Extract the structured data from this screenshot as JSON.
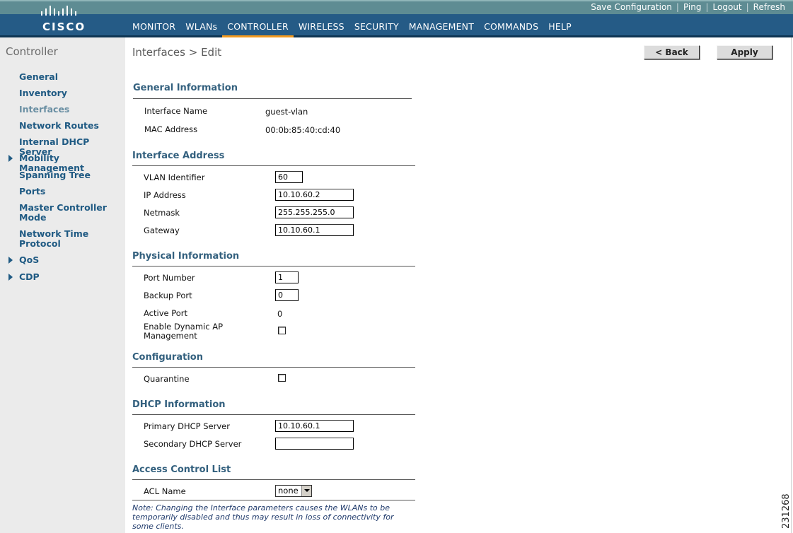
{
  "brand": {
    "logo_text": "CISCO"
  },
  "top_links": [
    "Save Configuration",
    "Ping",
    "Logout",
    "Refresh"
  ],
  "nav": {
    "items": [
      "MONITOR",
      "WLANs",
      "CONTROLLER",
      "WIRELESS",
      "SECURITY",
      "MANAGEMENT",
      "COMMANDS",
      "HELP"
    ],
    "active": "CONTROLLER",
    "active_color": "#f39a1f"
  },
  "sidebar": {
    "title": "Controller",
    "items": [
      {
        "label": "General",
        "expandable": false
      },
      {
        "label": "Inventory",
        "expandable": false
      },
      {
        "label": "Interfaces",
        "expandable": false,
        "active": true
      },
      {
        "label": "Network Routes",
        "expandable": false
      },
      {
        "label": "Internal DHCP Server",
        "expandable": false
      },
      {
        "label": "Mobility Management",
        "expandable": true
      },
      {
        "label": "Spanning Tree",
        "expandable": false
      },
      {
        "label": "Ports",
        "expandable": false
      },
      {
        "label": "Master Controller Mode",
        "expandable": false
      },
      {
        "label": "Network Time Protocol",
        "expandable": false
      },
      {
        "label": "QoS",
        "expandable": true
      },
      {
        "label": "CDP",
        "expandable": true
      }
    ]
  },
  "page": {
    "title": "Interfaces > Edit",
    "back_label": "< Back",
    "apply_label": "Apply"
  },
  "general": {
    "title": "General Information",
    "interface_name_label": "Interface Name",
    "interface_name": "guest-vlan",
    "mac_label": "MAC Address",
    "mac": "00:0b:85:40:cd:40"
  },
  "address": {
    "title": "Interface Address",
    "vlan_label": "VLAN Identifier",
    "vlan": "60",
    "ip_label": "IP Address",
    "ip": "10.10.60.2",
    "netmask_label": "Netmask",
    "netmask": "255.255.255.0",
    "gateway_label": "Gateway",
    "gateway": "10.10.60.1"
  },
  "physical": {
    "title": "Physical Information",
    "port_label": "Port Number",
    "port": "1",
    "backup_label": "Backup Port",
    "backup": "0",
    "active_label": "Active Port",
    "active": "0",
    "dynamic_ap_label_1": "Enable Dynamic AP",
    "dynamic_ap_label_2": "Management",
    "dynamic_ap_checked": false
  },
  "configuration": {
    "title": "Configuration",
    "quarantine_label": "Quarantine",
    "quarantine_checked": false
  },
  "dhcp": {
    "title": "DHCP Information",
    "primary_label": "Primary DHCP Server",
    "primary": "10.10.60.1",
    "secondary_label": "Secondary DHCP Server",
    "secondary": ""
  },
  "acl": {
    "title": "Access Control List",
    "name_label": "ACL Name",
    "selected": "none"
  },
  "note": "Note: Changing the Interface parameters causes the WLANs to be temporarily disabled and thus may result in loss of connectivity for some clients.",
  "figure_number": "231268"
}
